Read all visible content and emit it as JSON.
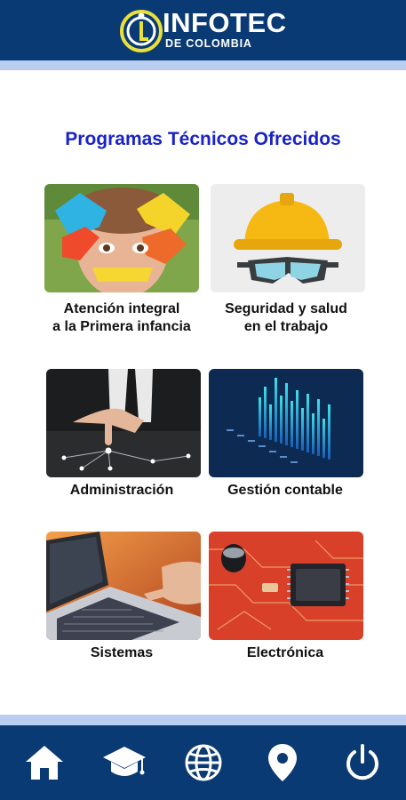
{
  "header": {
    "brand_title": "INFOTEC",
    "brand_subtitle": "DE COLOMBIA"
  },
  "page_title": "Programas Técnicos Ofrecidos",
  "programs": [
    {
      "line1": "Atención integral",
      "line2": "a la Primera infancia",
      "image": "child-painted-hands"
    },
    {
      "line1": "Seguridad y salud",
      "line2": "en el trabajo",
      "image": "hard-hat-goggles"
    },
    {
      "line1": "Administración",
      "line2": "",
      "image": "businessman-network"
    },
    {
      "line1": "Gestión contable",
      "line2": "",
      "image": "bar-data-visual"
    },
    {
      "line1": "Sistemas",
      "line2": "",
      "image": "laptop-keyboard"
    },
    {
      "line1": "Electrónica",
      "line2": "",
      "image": "circuit-board"
    }
  ],
  "bottom_nav": [
    {
      "icon": "home-icon"
    },
    {
      "icon": "graduation-cap-icon"
    },
    {
      "icon": "globe-icon"
    },
    {
      "icon": "location-pin-icon"
    },
    {
      "icon": "power-icon"
    }
  ],
  "colors": {
    "header_bg": "#0a3a73",
    "strip": "#b9cdf0",
    "title": "#1a23c7",
    "logo_accent": "#e9e03a"
  }
}
